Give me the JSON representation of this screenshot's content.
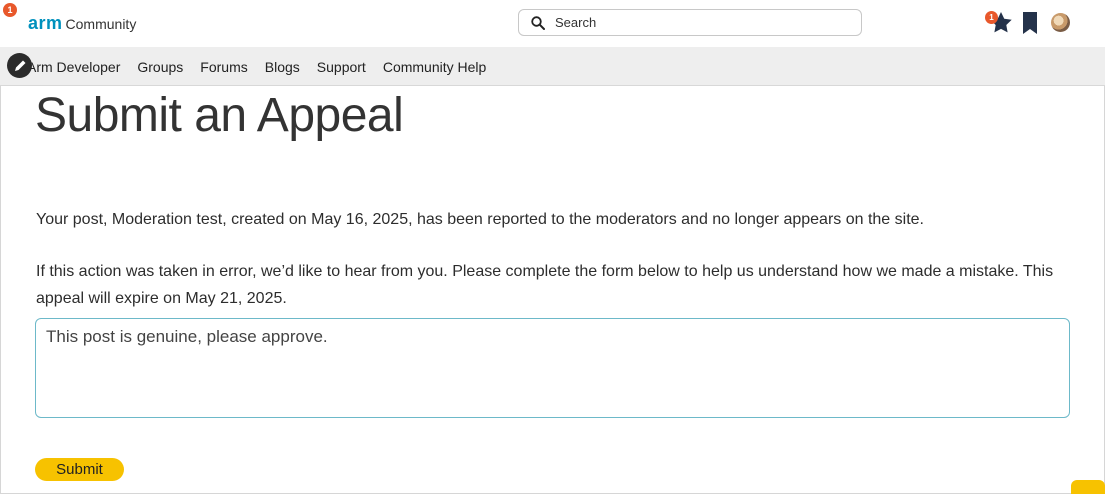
{
  "header": {
    "notification_count": "1",
    "logo_arm": "arm",
    "logo_community": "Community",
    "search_placeholder": "Search",
    "favorites_count": "1"
  },
  "nav": {
    "items": [
      {
        "label": "Arm Developer"
      },
      {
        "label": "Groups"
      },
      {
        "label": "Forums"
      },
      {
        "label": "Blogs"
      },
      {
        "label": "Support"
      },
      {
        "label": "Community Help"
      }
    ]
  },
  "main": {
    "title": "Submit an Appeal",
    "notice": "Your post, Moderation test, created on May 16, 2025, has been reported to the moderators and no longer appears on the site.",
    "instructions": "If this action was taken in error, we’d like to hear from you. Please complete the form below to help us understand how we made a mistake. This appeal will expire on May 21, 2025.",
    "appeal_text": "This post is genuine, please approve.",
    "submit_label": "Submit"
  },
  "colors": {
    "brand": "#0091bd",
    "accent": "#f7c200",
    "badge": "#e8582b"
  }
}
